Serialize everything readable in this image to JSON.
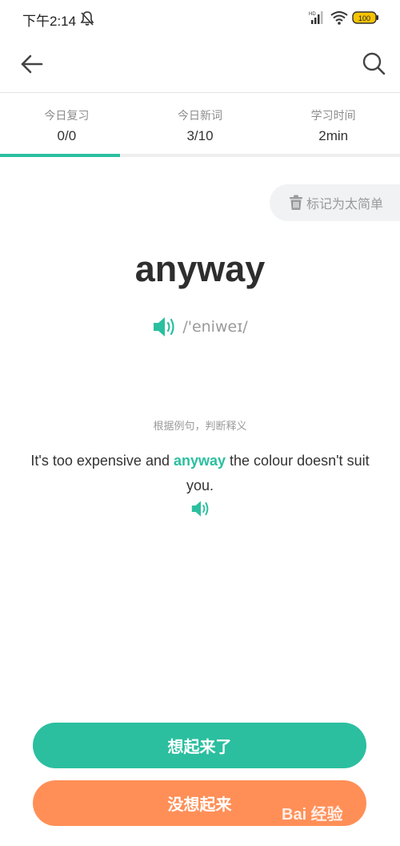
{
  "status_bar": {
    "time": "下午2:14",
    "battery": "100",
    "network": "HD"
  },
  "stats": [
    {
      "label": "今日复习",
      "value": "0/0"
    },
    {
      "label": "今日新词",
      "value": "3/10"
    },
    {
      "label": "学习时间",
      "value": "2min"
    }
  ],
  "progress": {
    "fraction": 0.3
  },
  "mark_easy_label": "标记为太简单",
  "word": "anyway",
  "phonetic": "/'eniweɪ/",
  "hint": "根据例句，判断释义",
  "sentence": {
    "before": "It's too expensive and ",
    "highlight": "anyway",
    "after": " the colour doesn't suit you."
  },
  "buttons": {
    "remember": "想起来了",
    "forgot": "没想起来"
  },
  "watermark": "Bai 经验",
  "colors": {
    "accent": "#2bbf9f",
    "orange": "#ff8f57",
    "text": "#333333",
    "muted": "#9a9a9a"
  }
}
